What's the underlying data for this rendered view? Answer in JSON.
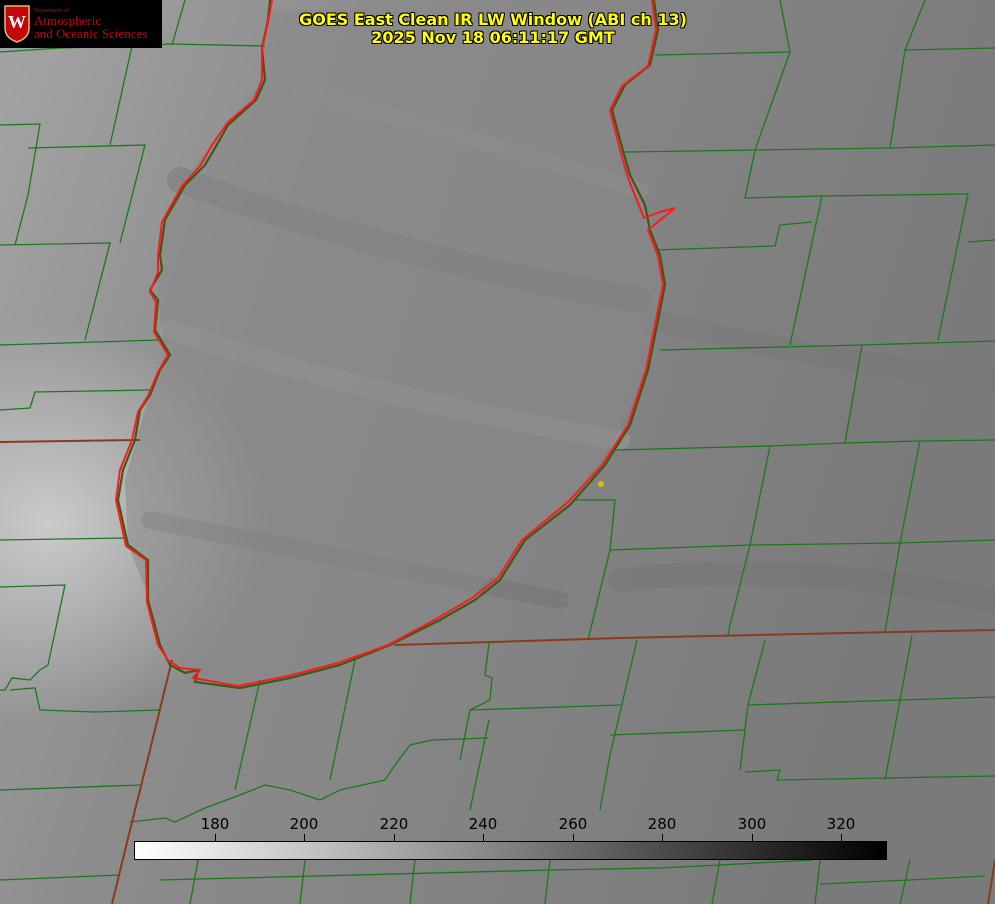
{
  "title": {
    "line1": "GOES East Clean IR LW Window (ABI ch 13)",
    "line2": "2025 Nov 18 06:11:17 GMT"
  },
  "logo": {
    "department": "Department of",
    "line1": "Atmospheric",
    "line2": "and Oceanic Sciences",
    "crest_letter": "W",
    "color": "#c5050c"
  },
  "colorbar": {
    "ticks": [
      "180",
      "200",
      "220",
      "240",
      "260",
      "280",
      "300",
      "320"
    ],
    "scale": "white (cold) to black (warm)"
  },
  "colors": {
    "county_lines": "#1a7a1a",
    "state_lines": "#8b3a1a",
    "lake_outline": "#ff1a1a",
    "marker": "#d4c200",
    "title": "#ffff00"
  }
}
